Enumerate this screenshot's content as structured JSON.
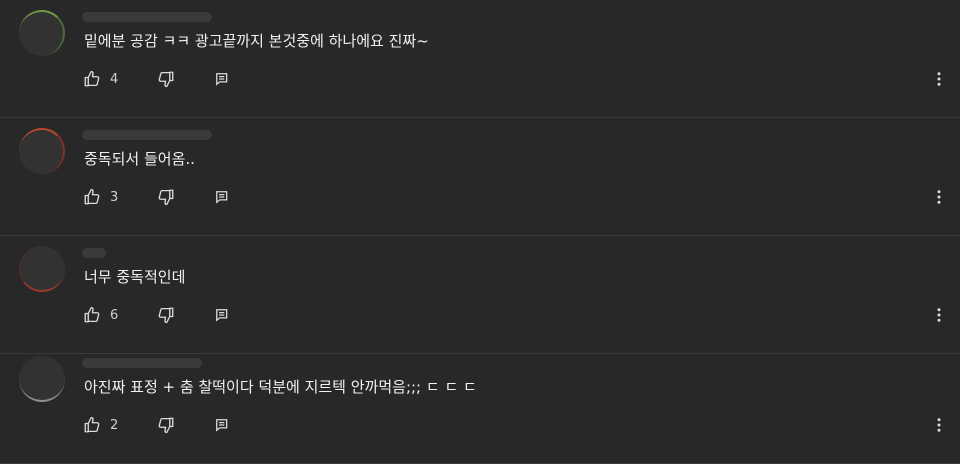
{
  "comments": [
    {
      "text": "밑에분 공감 ㅋㅋ 광고끝까지 본것중에 하나에요 진짜~",
      "likes": "4"
    },
    {
      "text": "중독되서 들어옴..",
      "likes": "3"
    },
    {
      "text": "너무 중독적인데",
      "likes": "6"
    },
    {
      "text": "아진짜 표정 + 춤 찰떡이다 덕분에 지르텍 안까먹음;;; ㄷ ㄷ ㄷ",
      "likes": "2"
    }
  ],
  "icons": {
    "like": "thumbs-up-icon",
    "dislike": "thumbs-down-icon",
    "reply": "reply-icon",
    "more": "more-vertical-icon"
  }
}
